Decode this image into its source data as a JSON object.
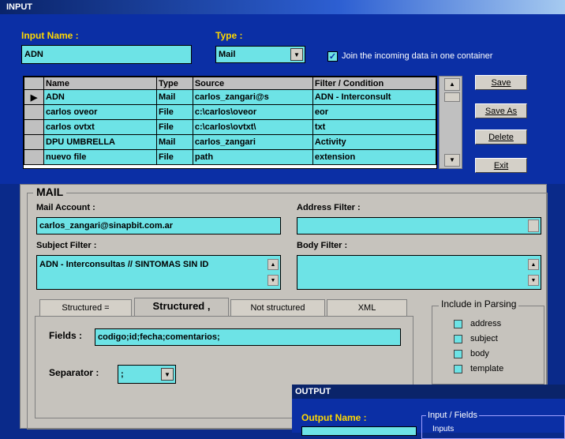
{
  "window": {
    "title": "INPUT"
  },
  "input_name": {
    "label": "Input Name :",
    "value": "ADN"
  },
  "type": {
    "label": "Type :",
    "value": "Mail"
  },
  "join": {
    "label": "Join the incoming data in one container",
    "checked": true
  },
  "grid": {
    "headers": [
      "Name",
      "Type",
      "Source",
      "Filter / Condition"
    ],
    "rows": [
      {
        "marker": "▶",
        "cells": [
          "ADN",
          "Mail",
          "carlos_zangari@s",
          "ADN - Interconsult"
        ]
      },
      {
        "marker": "",
        "cells": [
          "carlos oveor",
          "File",
          "c:\\carlos\\oveor",
          "eor"
        ]
      },
      {
        "marker": "",
        "cells": [
          "carlos ovtxt",
          "File",
          "c:\\carlos\\ovtxt\\",
          "txt"
        ]
      },
      {
        "marker": "",
        "cells": [
          "DPU UMBRELLA",
          "Mail",
          "carlos_zangari",
          "Activity"
        ]
      },
      {
        "marker": "",
        "cells": [
          "nuevo file",
          "File",
          "path",
          "extension"
        ]
      }
    ]
  },
  "buttons": {
    "save": "Save",
    "save_as": "Save As",
    "delete": "Delete",
    "exit": "Exit"
  },
  "mail": {
    "title": "MAIL",
    "account_label": "Mail Account :",
    "account_value": "carlos_zangari@sinapbit.com.ar",
    "address_label": "Address Filter :",
    "address_value": "",
    "subject_label": "Subject Filter :",
    "subject_value": "ADN - Interconsultas // SINTOMAS SIN ID",
    "body_label": "Body Filter :",
    "body_value": ""
  },
  "tabs": [
    "Structured =",
    "Structured ,",
    "Not structured",
    "XML"
  ],
  "active_tab_index": 1,
  "fields": {
    "label": "Fields :",
    "value": "codigo;id;fecha;comentarios;"
  },
  "separator": {
    "label": "Separator :",
    "value": ";"
  },
  "include": {
    "title": "Include in Parsing",
    "items": [
      "address",
      "subject",
      "body",
      "template"
    ]
  },
  "output": {
    "title": "OUTPUT",
    "name_label": "Output Name :",
    "group_label": "Input / Fields",
    "inputs_label": "Inputs"
  },
  "colors": {
    "accent_cyan": "#6de3e6",
    "panel_blue": "#0b2fa5",
    "label_yellow": "#ffd800"
  }
}
